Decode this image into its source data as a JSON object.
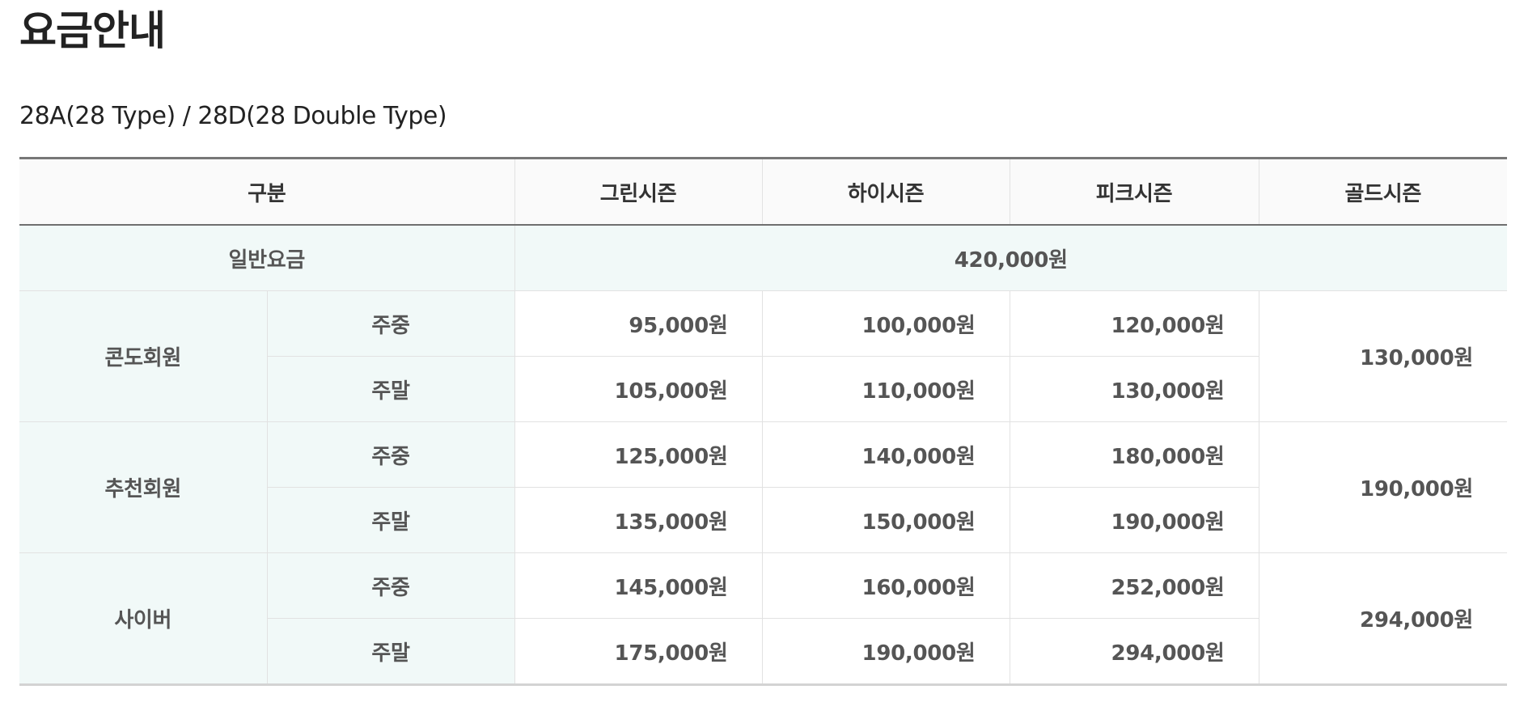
{
  "page": {
    "title": "요금안내",
    "room_type": "28A(28 Type) / 28D(28 Double Type)"
  },
  "table": {
    "headers": {
      "category": "구분",
      "green": "그린시즌",
      "high": "하이시즌",
      "peak": "피크시즌",
      "gold": "골드시즌"
    },
    "general": {
      "label": "일반요금",
      "price": "420,000원"
    },
    "groups": [
      {
        "label": "콘도회원",
        "gold": "130,000원",
        "rows": [
          {
            "day": "주중",
            "green": "95,000원",
            "high": "100,000원",
            "peak": "120,000원"
          },
          {
            "day": "주말",
            "green": "105,000원",
            "high": "110,000원",
            "peak": "130,000원"
          }
        ]
      },
      {
        "label": "추천회원",
        "gold": "190,000원",
        "rows": [
          {
            "day": "주중",
            "green": "125,000원",
            "high": "140,000원",
            "peak": "180,000원"
          },
          {
            "day": "주말",
            "green": "135,000원",
            "high": "150,000원",
            "peak": "190,000원"
          }
        ]
      },
      {
        "label": "사이버",
        "gold": "294,000원",
        "rows": [
          {
            "day": "주중",
            "green": "145,000원",
            "high": "160,000원",
            "peak": "252,000원"
          },
          {
            "day": "주말",
            "green": "175,000원",
            "high": "190,000원",
            "peak": "294,000원"
          }
        ]
      }
    ]
  },
  "colors": {
    "label_background": "#f1f9f8",
    "header_background": "#fafafa",
    "top_border": "#777777",
    "bottom_border": "#d3d3d3",
    "cell_border": "#e2e2e2"
  }
}
